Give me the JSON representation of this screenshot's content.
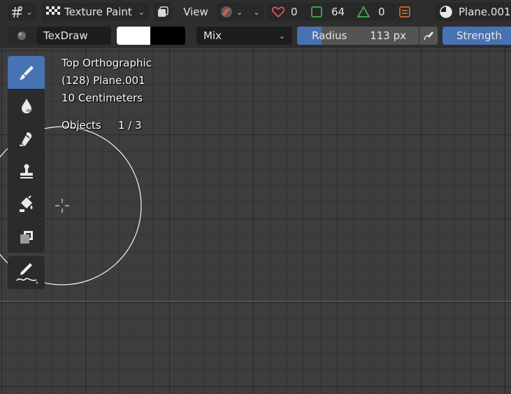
{
  "header": {
    "mode_label": "Texture Paint",
    "view_label": "View",
    "stats": {
      "vertices": "0",
      "faces": "64",
      "triangles": "0"
    },
    "object_name": "Plane.001"
  },
  "tool_settings": {
    "brush_name": "TexDraw",
    "color_primary": "#ffffff",
    "color_secondary": "#000000",
    "blend_mode": "Mix",
    "radius_label": "Radius",
    "radius_value": "113 px",
    "strength_label": "Strength"
  },
  "viewport": {
    "view_name": "Top Orthographic",
    "object_info": "(128) Plane.001",
    "scale": "10 Centimeters",
    "objects_label": "Objects",
    "objects_count": "1 / 3"
  },
  "toolbar": {
    "tools": [
      "draw-brush-icon",
      "soften-icon",
      "smear-icon",
      "clone-icon",
      "fill-icon",
      "mask-icon"
    ],
    "extra_tool": "annotate-icon"
  },
  "colors": {
    "accent": "#4772b3",
    "x_axis": "#a8484f",
    "stat_heart": "#e0554f",
    "stat_square": "#3fae4b",
    "stat_triangle": "#3fae4b"
  }
}
